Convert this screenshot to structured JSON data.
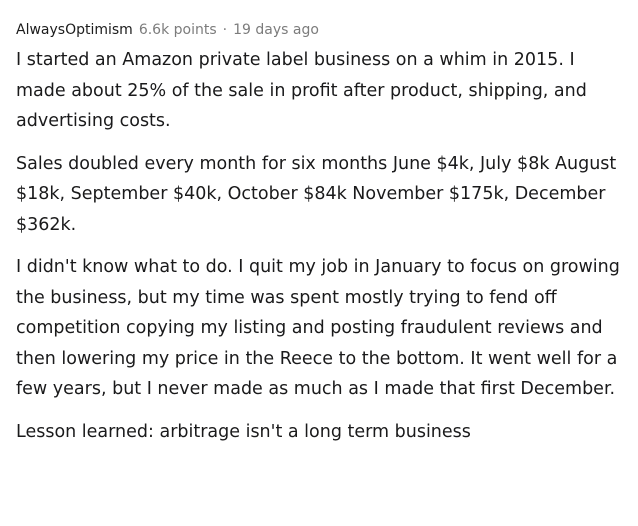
{
  "comment": {
    "author": "AlwaysOptimism",
    "points": "6.6k points",
    "separator": "·",
    "time": "19 days ago",
    "paragraphs": [
      "I started an Amazon private label business on a whim in 2015. I made about 25% of the sale in profit after product, shipping, and advertising costs.",
      "Sales doubled every month for six months June $4k, July $8k August $18k, September $40k, October $84k November $175k, December $362k.",
      "I didn't know what to do. I quit my job in January to focus on growing the business, but my time was spent mostly trying to fend off competition copying my listing and posting fraudulent reviews and then lowering my price in the Reece to the bottom. It went well for a few years, but I never made as much as I made that first December.",
      "Lesson learned: arbitrage isn't a long term business"
    ]
  }
}
